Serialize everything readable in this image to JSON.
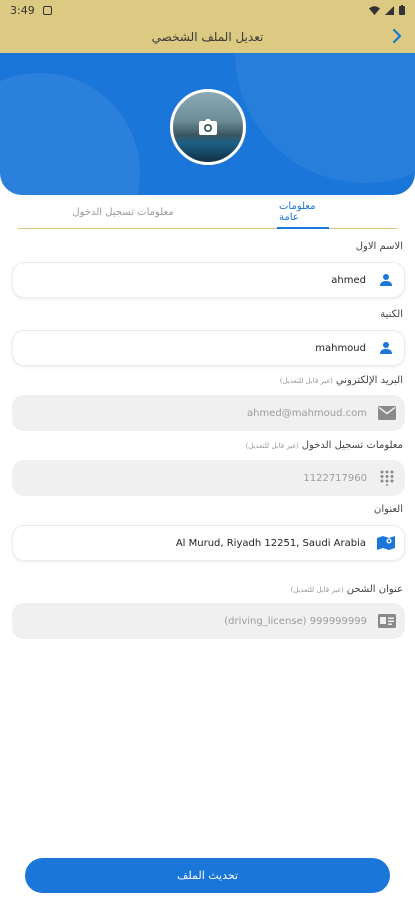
{
  "status_bar": {
    "time": "3:49"
  },
  "app_bar": {
    "title": "تعديل الملف الشخصي"
  },
  "tabs": [
    {
      "label": "معلومات عامة",
      "active": true
    },
    {
      "label": "معلومات تسجيل الدخول",
      "active": false
    }
  ],
  "fields": {
    "first_name": {
      "label": "الاسم الاول",
      "value": "ahmed",
      "icon": "person-icon"
    },
    "last_name": {
      "label": "الكنية",
      "value": "mahmoud",
      "icon": "person-icon"
    },
    "email": {
      "label": "البريد الإلكتروني",
      "hint": "(غير قابل للتعديل)",
      "value": "ahmed@mahmoud.com",
      "icon": "mail-icon"
    },
    "phone": {
      "label": "معلومات تسجيل الدخول",
      "hint": "(غير قابل للتعديل)",
      "value": "1122717960",
      "icon": "dialpad-icon"
    },
    "address": {
      "label": "العنوان",
      "value": "Al Murud, Riyadh 12251, Saudi Arabia",
      "icon": "map-icon"
    },
    "shipping": {
      "label": "عنوان الشحن",
      "hint": "(غير قابل للتعديل)",
      "value": "(driving_license) 999999999",
      "icon": "id-card-icon"
    }
  },
  "submit_button": {
    "label": "تحديث الملف"
  },
  "colors": {
    "primary": "#1a76d9",
    "gold": "#dcc982"
  }
}
